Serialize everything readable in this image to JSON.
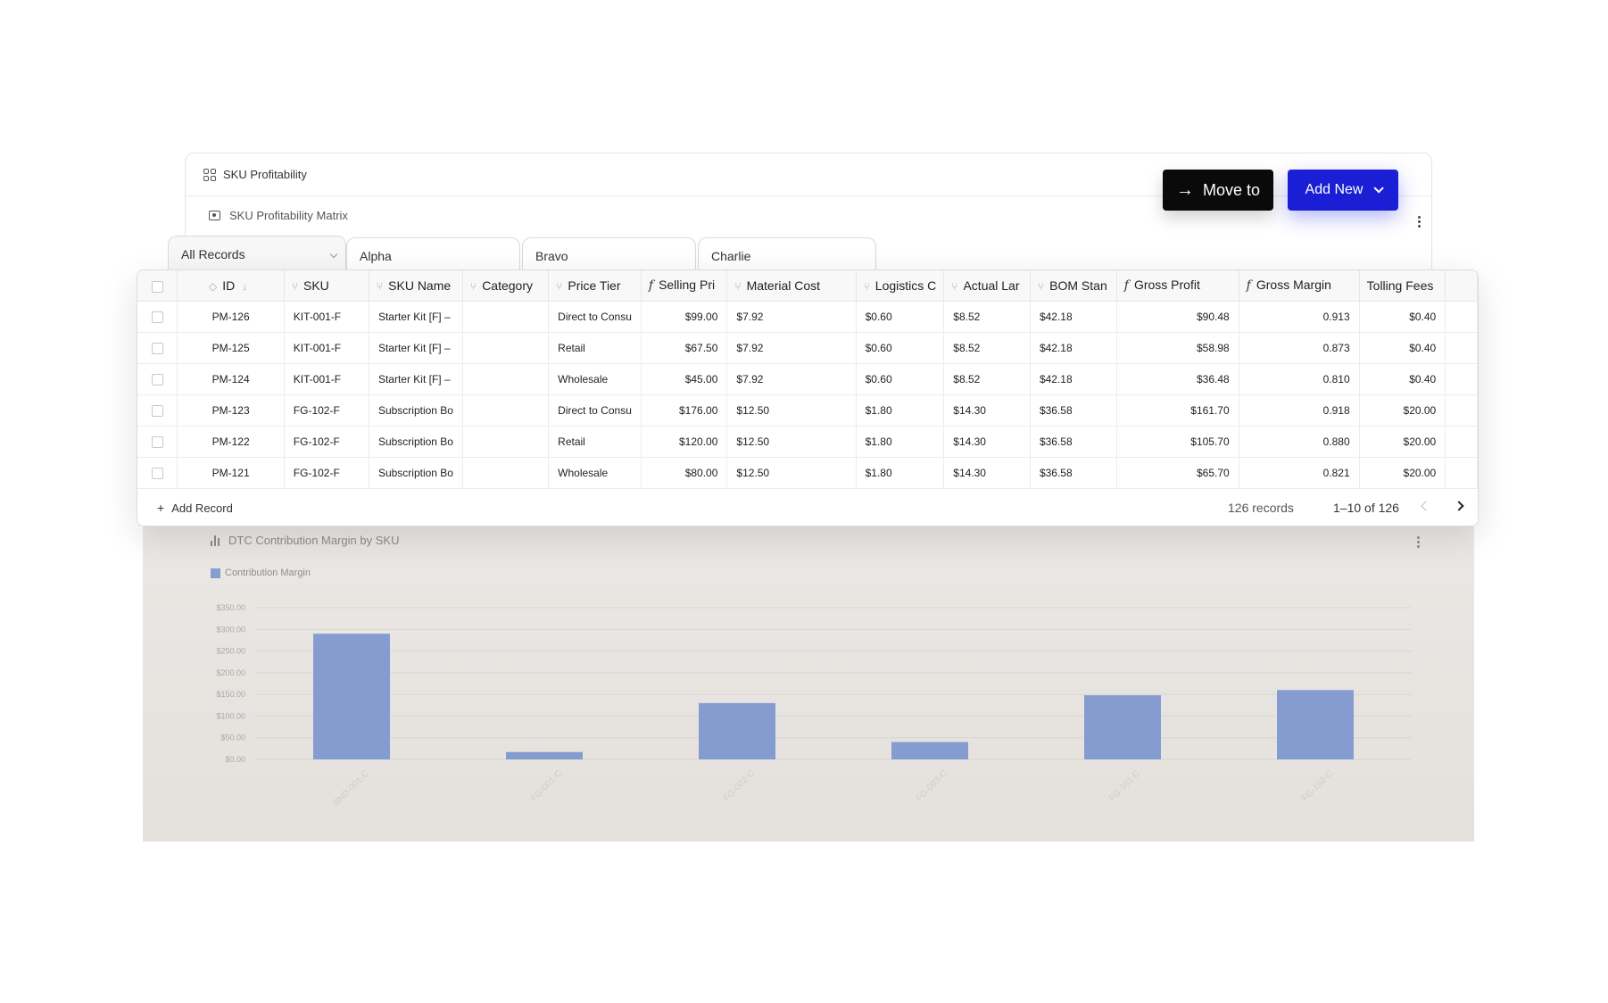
{
  "panel": {
    "title": "SKU Profitability",
    "matrix_title": "SKU Profitability Matrix"
  },
  "actions": {
    "move_label": "Move to",
    "add_label": "Add New"
  },
  "tabs": [
    {
      "label": "All Records",
      "active": true
    },
    {
      "label": "Alpha",
      "active": false
    },
    {
      "label": "Bravo",
      "active": false
    },
    {
      "label": "Charlie",
      "active": false
    }
  ],
  "table": {
    "columns": [
      "ID",
      "SKU",
      "SKU Name",
      "Category",
      "Price Tier",
      "Selling Pri",
      "Material Cost",
      "Logistics C",
      "Actual Lar",
      "BOM Stan",
      "Gross Profit",
      "Gross Margin",
      "Tolling Fees"
    ],
    "rows": [
      [
        "PM-126",
        "KIT-001-F",
        "Starter Kit [F] –",
        "",
        "Direct to Consu",
        "$99.00",
        "$7.92",
        "$0.60",
        "$8.52",
        "$42.18",
        "$90.48",
        "0.913",
        "$0.40"
      ],
      [
        "PM-125",
        "KIT-001-F",
        "Starter Kit [F] –",
        "",
        "Retail",
        "$67.50",
        "$7.92",
        "$0.60",
        "$8.52",
        "$42.18",
        "$58.98",
        "0.873",
        "$0.40"
      ],
      [
        "PM-124",
        "KIT-001-F",
        "Starter Kit [F] –",
        "",
        "Wholesale",
        "$45.00",
        "$7.92",
        "$0.60",
        "$8.52",
        "$42.18",
        "$36.48",
        "0.810",
        "$0.40"
      ],
      [
        "PM-123",
        "FG-102-F",
        "Subscription Bo",
        "",
        "Direct to Consu",
        "$176.00",
        "$12.50",
        "$1.80",
        "$14.30",
        "$36.58",
        "$161.70",
        "0.918",
        "$20.00"
      ],
      [
        "PM-122",
        "FG-102-F",
        "Subscription Bo",
        "",
        "Retail",
        "$120.00",
        "$12.50",
        "$1.80",
        "$14.30",
        "$36.58",
        "$105.70",
        "0.880",
        "$20.00"
      ],
      [
        "PM-121",
        "FG-102-F",
        "Subscription Bo",
        "",
        "Wholesale",
        "$80.00",
        "$12.50",
        "$1.80",
        "$14.30",
        "$36.58",
        "$65.70",
        "0.821",
        "$20.00"
      ]
    ],
    "add_record_label": "Add Record",
    "record_count": "126 records",
    "page_range": "1–10 of 126"
  },
  "chart_data": {
    "type": "bar",
    "title": "DTC Contribution Margin by SKU",
    "series": [
      {
        "name": "Contribution Margin",
        "values": [
          290,
          17,
          130,
          40,
          148,
          160
        ]
      }
    ],
    "categories": [
      "BND-001-C",
      "FG-001-C",
      "FG-002-C",
      "FG-003-C",
      "FG-101-C",
      "FG-102-C"
    ],
    "yticks": [
      "$0.00",
      "$50.00",
      "$100.00",
      "$150.00",
      "$200.00",
      "$250.00",
      "$300.00",
      "$350.00"
    ],
    "ylim": [
      0,
      350
    ],
    "bar_color": "#3763c5",
    "legend": "top-left",
    "grid": true
  },
  "colors": {
    "accent": "#1a1fd6",
    "move_button": "#0a0a0a"
  }
}
